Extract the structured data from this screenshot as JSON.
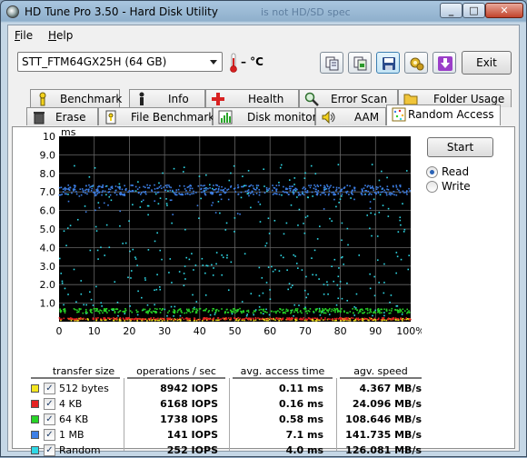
{
  "window": {
    "title": "HD Tune Pro 3.50 - Hard Disk Utility",
    "title_ghost": "is not HD/SD spec",
    "min_label": "_",
    "max_label": "□",
    "close_label": "✕"
  },
  "menu": [
    {
      "label": "File",
      "accel": "F",
      "rest": "ile"
    },
    {
      "label": "Help",
      "accel": "H",
      "rest": "elp"
    }
  ],
  "toolbar": {
    "drive": "STT_FTM64GX25H (64 GB)",
    "temperature": "– °C",
    "buttons": [
      "copy-icon",
      "compare-icon",
      "save-icon",
      "options-icon",
      "download-icon"
    ],
    "exit_label": "Exit"
  },
  "tabs_row1": [
    {
      "label": "Benchmark",
      "icon": "benchmark-icon"
    },
    {
      "label": "Info",
      "icon": "info-icon"
    },
    {
      "label": "Health",
      "icon": "health-icon"
    },
    {
      "label": "Error Scan",
      "icon": "error-scan-icon"
    },
    {
      "label": "Folder Usage",
      "icon": "folder-icon"
    }
  ],
  "tabs_row2": [
    {
      "label": "Erase",
      "icon": "erase-icon"
    },
    {
      "label": "File Benchmark",
      "icon": "file-benchmark-icon"
    },
    {
      "label": "Disk monitor",
      "icon": "disk-monitor-icon"
    },
    {
      "label": "AAM",
      "icon": "speaker-icon"
    },
    {
      "label": "Random Access",
      "icon": "random-access-icon",
      "active": true
    }
  ],
  "controls": {
    "start_label": "Start",
    "read_label": "Read",
    "write_label": "Write",
    "selected": "Read"
  },
  "chart_data": {
    "type": "scatter",
    "ylabel": "ms",
    "ylim": [
      0,
      10
    ],
    "xlim": [
      0,
      100
    ],
    "y_ticks": [
      "10",
      "9.0",
      "8.0",
      "7.0",
      "6.0",
      "5.0",
      "4.0",
      "3.0",
      "2.0",
      "1.0"
    ],
    "x_ticks": [
      "0",
      "10",
      "20",
      "30",
      "40",
      "50",
      "60",
      "70",
      "80",
      "90",
      "100%"
    ],
    "grid": true,
    "series": [
      {
        "name": "512 bytes",
        "color": "#f3e51f",
        "mean_ms": 0.11
      },
      {
        "name": "4 KB",
        "color": "#e52222",
        "mean_ms": 0.16
      },
      {
        "name": "64 KB",
        "color": "#27d427",
        "mean_ms": 0.58
      },
      {
        "name": "1 MB",
        "color": "#3d7fe6",
        "mean_ms": 7.1
      },
      {
        "name": "Random",
        "color": "#2fd8e6",
        "mean_ms": 4.0
      }
    ]
  },
  "results": {
    "headers": [
      "transfer size",
      "operations / sec",
      "avg. access time",
      "agv. speed"
    ],
    "rows": [
      {
        "size": "512 bytes",
        "color": "#f3e51f",
        "ops": "8942 IOPS",
        "access": "0.11 ms",
        "speed": "4.367 MB/s"
      },
      {
        "size": "4 KB",
        "color": "#e52222",
        "ops": "6168 IOPS",
        "access": "0.16 ms",
        "speed": "24.096 MB/s"
      },
      {
        "size": "64 KB",
        "color": "#27d427",
        "ops": "1738 IOPS",
        "access": "0.58 ms",
        "speed": "108.646 MB/s"
      },
      {
        "size": "1 MB",
        "color": "#3d7fe6",
        "ops": "141 IOPS",
        "access": "7.1 ms",
        "speed": "141.735 MB/s"
      },
      {
        "size": "Random",
        "color": "#2fd8e6",
        "ops": "252 IOPS",
        "access": "4.0 ms",
        "speed": "126.081 MB/s"
      }
    ],
    "check_glyph": "✓"
  }
}
